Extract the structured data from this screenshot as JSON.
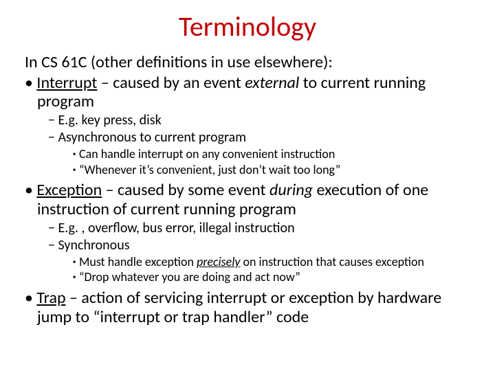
{
  "title": "Terminology",
  "intro": "In CS 61C (other definitions in use elsewhere):",
  "interrupt": {
    "term": "Interrupt",
    "dash_and_pre": " – caused by an event ",
    "em": "external",
    "post": " to current running program",
    "sub1": "E.g. key press, disk",
    "sub2": "Asynchronous to current program",
    "sub2a": "Can handle interrupt on any convenient instruction",
    "sub2b": "“Whenever it’s convenient, just don’t wait too long”"
  },
  "exception": {
    "term": "Exception",
    "dash_and_pre": " – caused by some event ",
    "em": "during",
    "post": " execution of one instruction of current running program",
    "sub1": "E.g. , overflow, bus error, illegal instruction",
    "sub2": "Synchronous",
    "sub2a_pre": "Must handle exception ",
    "sub2a_em": "precisely",
    "sub2a_post": " on instruction that causes exception",
    "sub2b": "“Drop whatever you are doing and act now”"
  },
  "trap": {
    "term": "Trap",
    "rest": " – action of servicing interrupt or exception by hardware jump to “interrupt or trap handler” code"
  }
}
